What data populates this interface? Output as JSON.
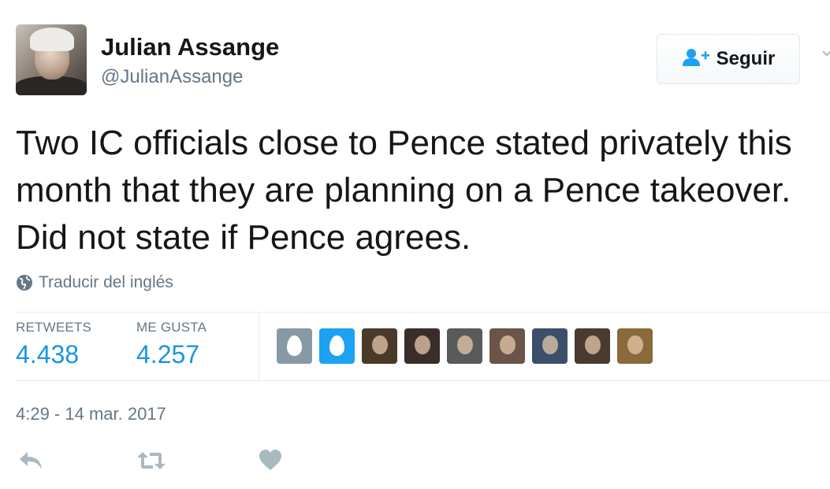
{
  "tweet": {
    "display_name": "Julian Assange",
    "username": "@JulianAssange",
    "text": "Two IC officials close to Pence stated privately this month that they are planning on a Pence takeover. Did not state if Pence agrees.",
    "translate_label": "Traducir del inglés",
    "timestamp": "4:29 - 14 mar. 2017"
  },
  "follow_button": {
    "label": "Seguir",
    "icon": "add-user-icon"
  },
  "stats": {
    "retweets_label": "RETWEETS",
    "retweets_count": "4.438",
    "likes_label": "ME GUSTA",
    "likes_count": "4.257"
  },
  "likers": [
    {
      "type": "egg",
      "bg": "#8899a6"
    },
    {
      "type": "egg",
      "bg": "#1da1f2"
    },
    {
      "type": "photo",
      "bg": "#4a3a2a"
    },
    {
      "type": "photo",
      "bg": "#3a2e2a"
    },
    {
      "type": "photo",
      "bg": "#5a5a5a"
    },
    {
      "type": "photo",
      "bg": "#6b5548"
    },
    {
      "type": "photo",
      "bg": "#3b4f6a"
    },
    {
      "type": "photo",
      "bg": "#4a3b30"
    },
    {
      "type": "photo",
      "bg": "#8a6a3a"
    }
  ],
  "actions": [
    {
      "name": "reply",
      "icon": "reply-icon"
    },
    {
      "name": "retweet",
      "icon": "retweet-icon"
    },
    {
      "name": "like",
      "icon": "heart-icon"
    }
  ],
  "colors": {
    "accent": "#1b95e0",
    "text": "#14171a",
    "muted": "#657786",
    "action_icon": "#aab8c2"
  }
}
